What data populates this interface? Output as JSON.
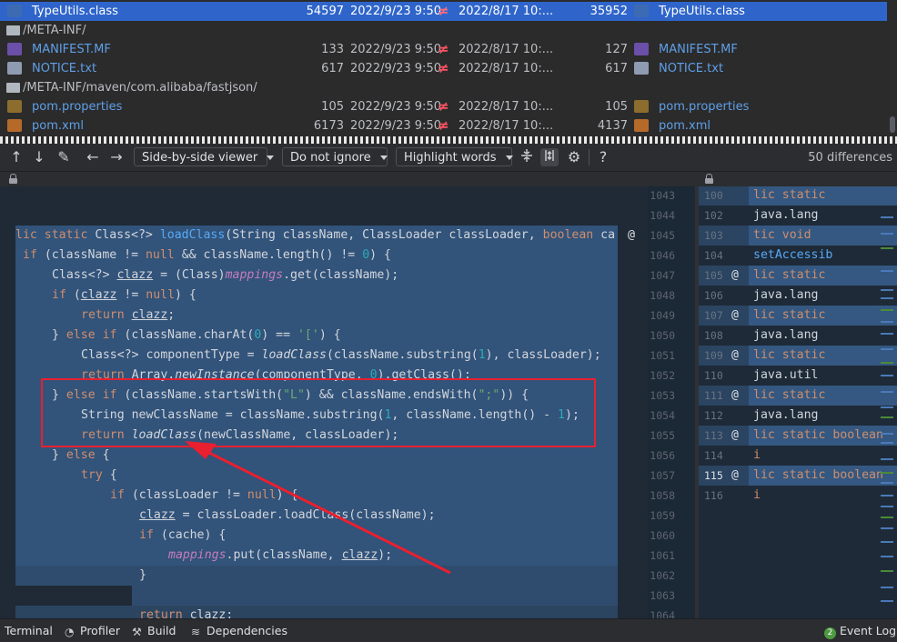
{
  "file_list": {
    "rows": [
      {
        "type": "file",
        "name": "TypeUtils.class",
        "icon": "class-file-icon",
        "size_left": "54597",
        "date_left": "2022/9/23 9:50",
        "diff": "≠",
        "date_right": "2022/8/17 10:...",
        "size_right": "35952",
        "right_name": "TypeUtils.class",
        "selected": true
      },
      {
        "type": "dir",
        "name": "/META-INF/"
      },
      {
        "type": "file",
        "name": "MANIFEST.MF",
        "icon": "manifest-file-icon",
        "size_left": "133",
        "date_left": "2022/9/23 9:50",
        "diff": "≠",
        "date_right": "2022/8/17 10:...",
        "size_right": "127",
        "right_name": "MANIFEST.MF"
      },
      {
        "type": "file",
        "name": "NOTICE.txt",
        "icon": "text-file-icon",
        "size_left": "617",
        "date_left": "2022/9/23 9:50",
        "diff": "≠",
        "date_right": "2022/8/17 10:...",
        "size_right": "617",
        "right_name": "NOTICE.txt"
      },
      {
        "type": "dir",
        "name": "/META-INF/maven/com.alibaba/fastjson/"
      },
      {
        "type": "file",
        "name": "pom.properties",
        "icon": "properties-file-icon",
        "size_left": "105",
        "date_left": "2022/9/23 9:50",
        "diff": "≠",
        "date_right": "2022/8/17 10:...",
        "size_right": "105",
        "right_name": "pom.properties"
      },
      {
        "type": "file",
        "name": "pom.xml",
        "icon": "xml-file-icon",
        "size_left": "6173",
        "date_left": "2022/9/23 9:50",
        "diff": "≠",
        "date_right": "2022/8/17 10:...",
        "size_right": "4137",
        "right_name": "pom.xml"
      }
    ]
  },
  "toolbar": {
    "viewer_label": "Side-by-side viewer",
    "ignore_label": "Do not ignore",
    "highlight_label": "Highlight words",
    "help_label": "?",
    "diff_count": "50 differences"
  },
  "left_editor": {
    "lines": [
      "lic static Class<?> loadClass(String className, ClassLoader classLoader, boolean ca",
      "if (className != null && className.length() != 0) {",
      "    Class<?> clazz = (Class)mappings.get(className);",
      "    if (clazz != null) {",
      "        return clazz;",
      "    } else if (className.charAt(0) == '[') {",
      "        Class<?> componentType = loadClass(className.substring(1), classLoader);",
      "        return Array.newInstance(componentType, 0).getClass();",
      "    } else if (className.startsWith(\"L\") && className.endsWith(\";\")) {",
      "        String newClassName = className.substring(1, className.length() - 1);",
      "        return loadClass(newClassName, classLoader);",
      "    } else {",
      "        try {",
      "            if (classLoader != null) {",
      "                clazz = classLoader.loadClass(className);",
      "                if (cache) {",
      "                    mappings.put(className, clazz);",
      "                }",
      "",
      "            return clazz;"
    ],
    "gutter_at": "@"
  },
  "middle_gutter": {
    "line_numbers": [
      "1043",
      "1044",
      "1045",
      "1046",
      "1047",
      "1048",
      "1049",
      "1050",
      "1051",
      "1052",
      "1053",
      "1054",
      "1055",
      "1056",
      "1057",
      "1058",
      "1059",
      "1060",
      "1061",
      "1062",
      "1063",
      "1064"
    ]
  },
  "right_editor": {
    "lines": [
      {
        "num": "100",
        "at": "",
        "code": "lic static java.lang"
      },
      {
        "num": "102",
        "at": "",
        "code": ""
      },
      {
        "num": "103",
        "at": "",
        "code": "tic void setAccessib"
      },
      {
        "num": "104",
        "at": "",
        "code": ""
      },
      {
        "num": "105",
        "at": "@",
        "code": "lic static java.lang"
      },
      {
        "num": "106",
        "at": "",
        "code": ""
      },
      {
        "num": "107",
        "at": "@",
        "code": "lic static java.lang"
      },
      {
        "num": "108",
        "at": "",
        "code": ""
      },
      {
        "num": "109",
        "at": "@",
        "code": "lic static java.util"
      },
      {
        "num": "110",
        "at": "",
        "code": ""
      },
      {
        "num": "111",
        "at": "@",
        "code": "lic static java.lang"
      },
      {
        "num": "112",
        "at": "",
        "code": ""
      },
      {
        "num": "113",
        "at": "@",
        "code": "lic static boolean i"
      },
      {
        "num": "114",
        "at": "",
        "code": ""
      },
      {
        "num": "115",
        "at": "@",
        "code": "lic static boolean i"
      },
      {
        "num": "116",
        "at": "",
        "code": ""
      }
    ]
  },
  "bottom_bar": {
    "terminal": "Terminal",
    "profiler": "Profiler",
    "build": "Build",
    "dependencies": "Dependencies",
    "event_log": "Event Log",
    "event_count": "2"
  },
  "colors": {
    "selection": "#2f65ca",
    "diff_mark": "#ff5261",
    "annotation_red": "#e8202f",
    "keyword": "#cf8e6d",
    "function": "#57aaf7",
    "string": "#6aab73"
  }
}
